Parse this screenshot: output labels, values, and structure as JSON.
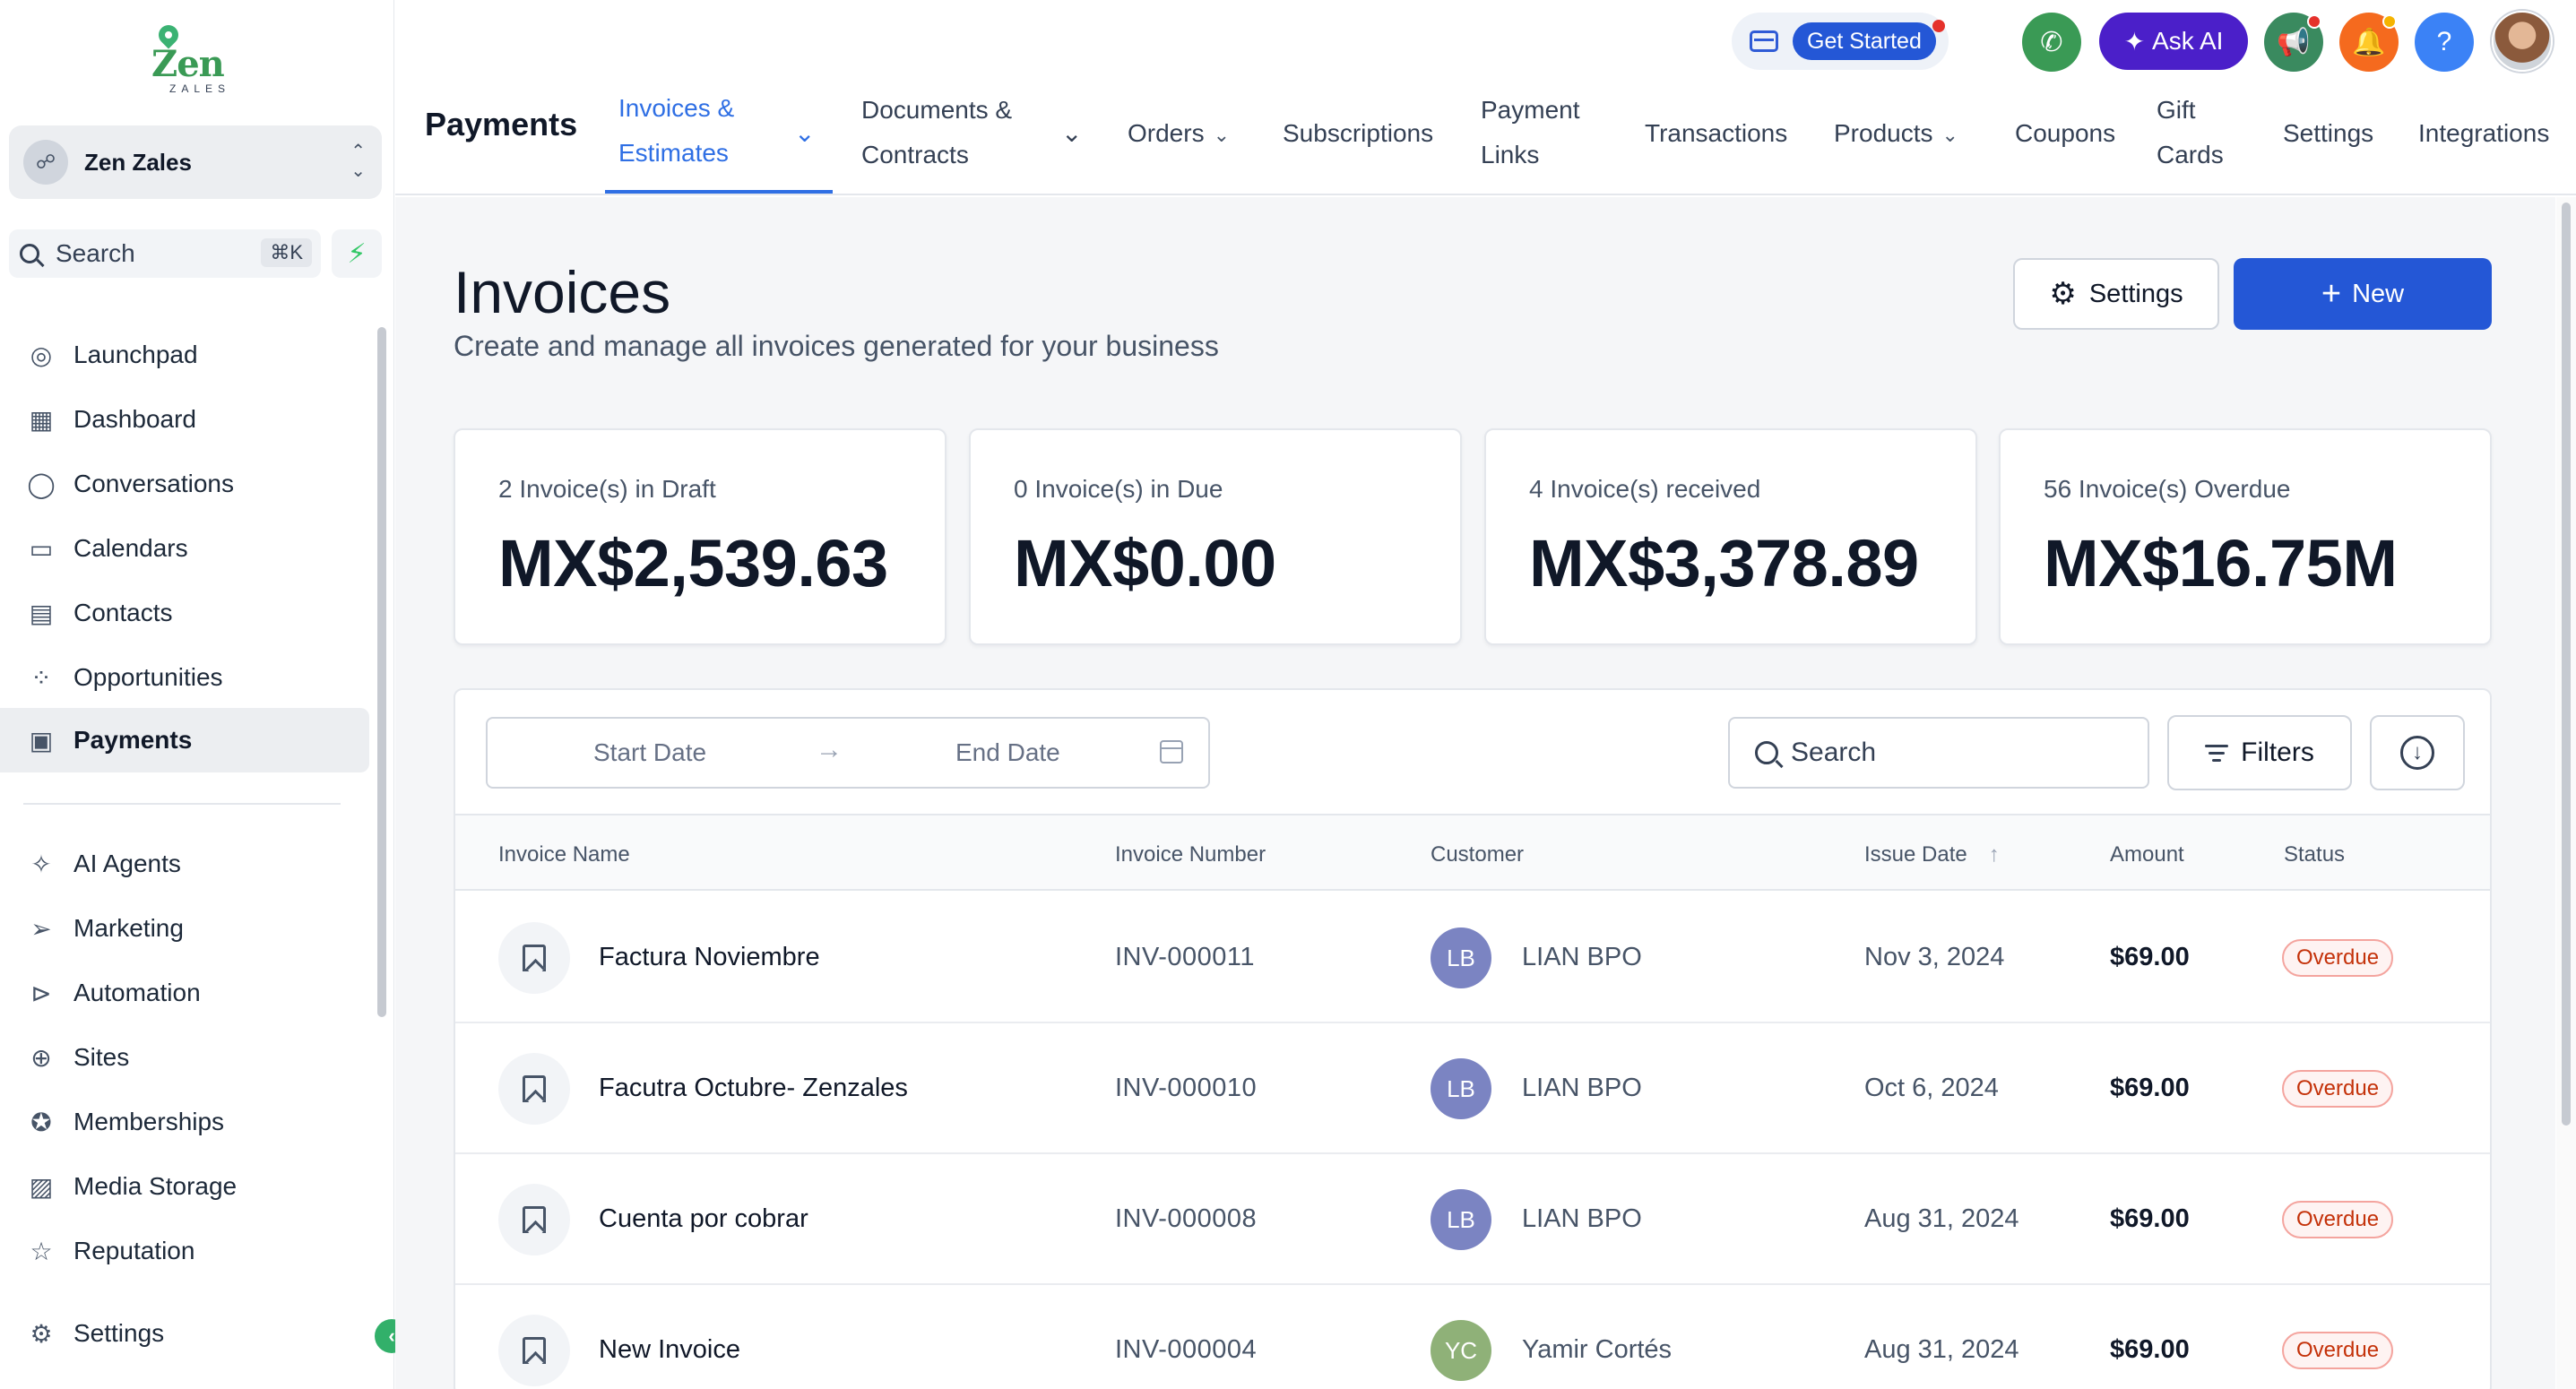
{
  "brand": {
    "logo_text": "Zen",
    "logo_sub": "ZALES"
  },
  "account": {
    "name": "Zen Zales"
  },
  "sidebar": {
    "search_label": "Search",
    "search_shortcut": "⌘K",
    "items": [
      {
        "label": "Launchpad",
        "icon": "launchpad-icon"
      },
      {
        "label": "Dashboard",
        "icon": "dashboard-icon"
      },
      {
        "label": "Conversations",
        "icon": "chat-bubble-icon"
      },
      {
        "label": "Calendars",
        "icon": "calendar-icon"
      },
      {
        "label": "Contacts",
        "icon": "contacts-icon"
      },
      {
        "label": "Opportunities",
        "icon": "opportunities-icon"
      },
      {
        "label": "Payments",
        "icon": "payments-icon",
        "active": true
      }
    ],
    "items2": [
      {
        "label": "AI Agents",
        "icon": "sparkles-icon"
      },
      {
        "label": "Marketing",
        "icon": "send-icon"
      },
      {
        "label": "Automation",
        "icon": "play-circle-icon"
      },
      {
        "label": "Sites",
        "icon": "globe-icon"
      },
      {
        "label": "Memberships",
        "icon": "award-icon"
      },
      {
        "label": "Media Storage",
        "icon": "image-icon"
      },
      {
        "label": "Reputation",
        "icon": "star-icon"
      }
    ],
    "settings_label": "Settings"
  },
  "topbar": {
    "get_started": "Get Started",
    "ask_ai": "Ask AI",
    "help": "?"
  },
  "header": {
    "page_name": "Payments",
    "tabs": [
      {
        "line1": "Invoices &",
        "line2": "Estimates",
        "dropdown": true,
        "active": true
      },
      {
        "line1": "Documents &",
        "line2": "Contracts",
        "dropdown": true
      },
      {
        "label": "Orders",
        "dropdown": true
      },
      {
        "label": "Subscriptions"
      },
      {
        "line1": "Payment",
        "line2": "Links"
      },
      {
        "label": "Transactions"
      },
      {
        "label": "Products",
        "dropdown": true
      },
      {
        "label": "Coupons"
      },
      {
        "line1": "Gift",
        "line2": "Cards"
      },
      {
        "label": "Settings"
      },
      {
        "label": "Integrations"
      }
    ]
  },
  "main": {
    "title": "Invoices",
    "subtitle": "Create and manage all invoices generated for your business",
    "settings_button": "Settings",
    "new_button": "New"
  },
  "stats": [
    {
      "label": "2 Invoice(s) in Draft",
      "value": "MX$2,539.63"
    },
    {
      "label": "0 Invoice(s) in Due",
      "value": "MX$0.00"
    },
    {
      "label": "4 Invoice(s) received",
      "value": "MX$3,378.89"
    },
    {
      "label": "56 Invoice(s) Overdue",
      "value": "MX$16.75M"
    }
  ],
  "table": {
    "start_date": "Start Date",
    "end_date": "End Date",
    "search_placeholder": "Search",
    "filters_label": "Filters",
    "columns": [
      "Invoice Name",
      "Invoice Number",
      "Customer",
      "Issue Date",
      "Amount",
      "Status"
    ],
    "rows": [
      {
        "name": "Factura Noviembre",
        "number": "INV-000011",
        "initials": "LB",
        "customer": "LIAN BPO",
        "date": "Nov 3, 2024",
        "amount": "$69.00",
        "status": "Overdue",
        "avatar_color": "#7b84c2"
      },
      {
        "name": "Facutra Octubre- Zenzales",
        "number": "INV-000010",
        "initials": "LB",
        "customer": "LIAN BPO",
        "date": "Oct 6, 2024",
        "amount": "$69.00",
        "status": "Overdue",
        "avatar_color": "#7b84c2"
      },
      {
        "name": "Cuenta por cobrar",
        "number": "INV-000008",
        "initials": "LB",
        "customer": "LIAN BPO",
        "date": "Aug 31, 2024",
        "amount": "$69.00",
        "status": "Overdue",
        "avatar_color": "#7b84c2"
      },
      {
        "name": "New Invoice",
        "number": "INV-000004",
        "initials": "YC",
        "customer": "Yamir Cortés",
        "date": "Aug 31, 2024",
        "amount": "$69.00",
        "status": "Overdue",
        "avatar_color": "#8fb178"
      }
    ]
  },
  "colors": {
    "primary": "#2457d6",
    "tab_active": "#2f6fe4",
    "ask_ai": "#4b1fc9",
    "phone": "#3a9a55",
    "notify": "#f56a1e",
    "help": "#3b82f6",
    "overdue": "#c4320a"
  }
}
